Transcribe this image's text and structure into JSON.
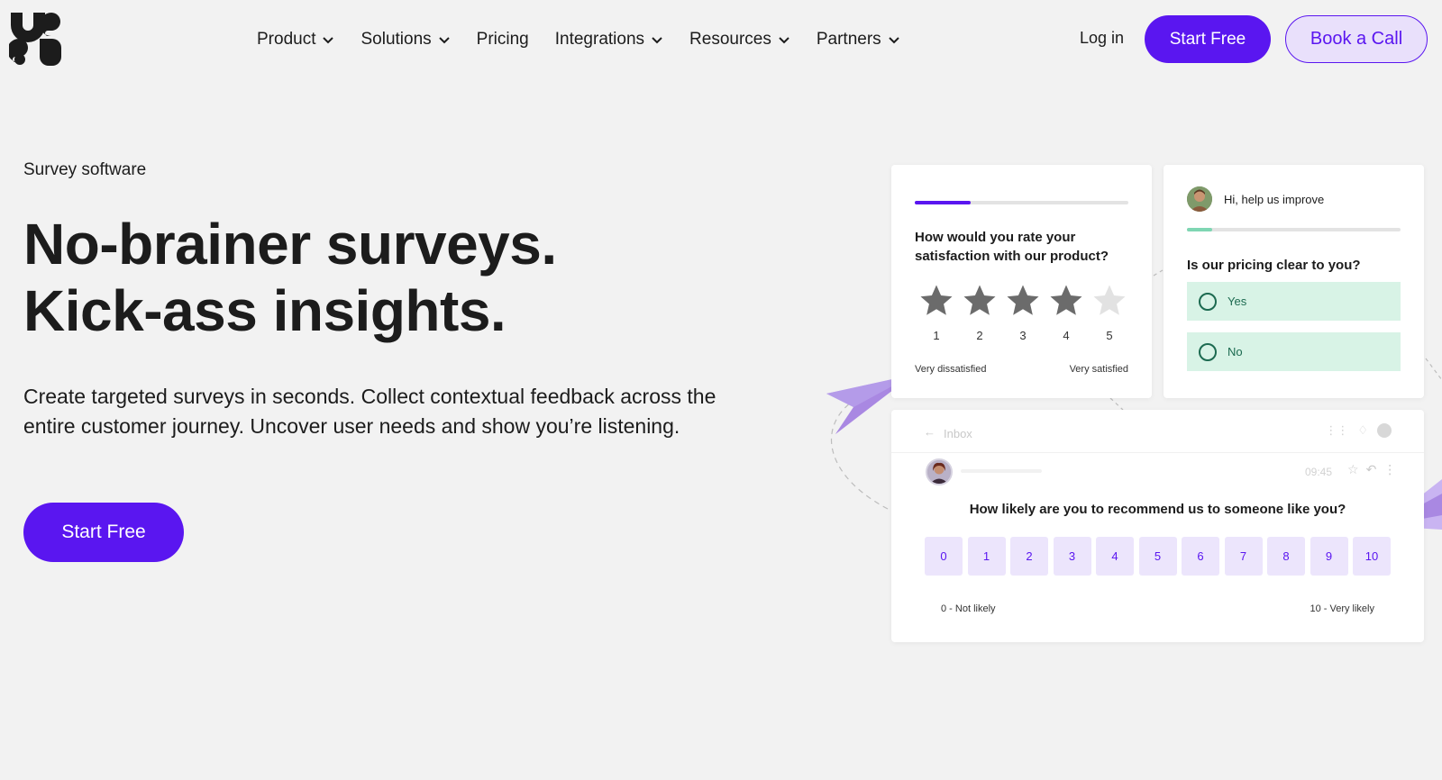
{
  "brand": {
    "accent_color": "#5a16f0",
    "accent_light": "#e9e0fb",
    "logo_icon": "survicate-logo-icon"
  },
  "nav": {
    "items": [
      {
        "label": "Product",
        "has_dropdown": true
      },
      {
        "label": "Solutions",
        "has_dropdown": true
      },
      {
        "label": "Pricing",
        "has_dropdown": false
      },
      {
        "label": "Integrations",
        "has_dropdown": true
      },
      {
        "label": "Resources",
        "has_dropdown": true
      },
      {
        "label": "Partners",
        "has_dropdown": true
      }
    ],
    "login_label": "Log in",
    "start_label": "Start Free",
    "book_label": "Book a Call"
  },
  "hero": {
    "eyebrow": "Survey software",
    "headline_line1": "No-brainer surveys.",
    "headline_line2": "Kick-ass insights.",
    "description": "Create targeted surveys in seconds. Collect contextual feedback across the entire customer journey. Uncover user needs and show you’re listening.",
    "cta_label": "Start Free"
  },
  "rating_card": {
    "progress": 0.26,
    "progress_color": "#5a16f0",
    "question": "How would you rate your satisfaction with our product?",
    "stars": [
      {
        "num": "1",
        "filled": true
      },
      {
        "num": "2",
        "filled": true
      },
      {
        "num": "3",
        "filled": true
      },
      {
        "num": "4",
        "filled": true
      },
      {
        "num": "5",
        "filled": false
      }
    ],
    "low_label": "Very dissatisfied",
    "high_label": "Very satisfied"
  },
  "pricing_card": {
    "greeting": "Hi, help us improve",
    "progress": 0.12,
    "progress_color": "#7fd6b3",
    "question": "Is our pricing clear to you?",
    "options": [
      "Yes",
      "No"
    ]
  },
  "nps_card": {
    "inbox_label": "Inbox",
    "time": "09:45",
    "question": "How likely are you to recommend us to someone like you?",
    "scale": [
      "0",
      "1",
      "2",
      "3",
      "4",
      "5",
      "6",
      "7",
      "8",
      "9",
      "10"
    ],
    "low_label": "0 - Not likely",
    "high_label": "10 - Very likely"
  }
}
